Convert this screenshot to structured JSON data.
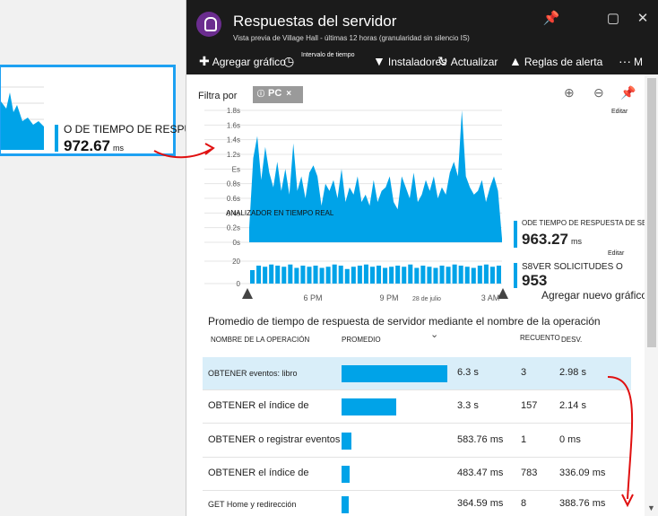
{
  "tile": {
    "metric_label": "O DE TIEMPO DE RESPUESTA DE SERVIDOR",
    "metric_value": "972.67",
    "metric_unit": "ms"
  },
  "blade": {
    "title": "Respuestas del servidor",
    "subtitle": "Vista previa de Village Hall - últimas 12 horas (granularidad sin silencio IS)",
    "controls": {
      "pin": "pin-icon",
      "maximize": "maximize-icon",
      "close": "close-icon"
    }
  },
  "toolbar": {
    "add_chart": "Agregar gráfico",
    "time_range": "Intervalo de tiempo",
    "installers": "Instaladores",
    "refresh": "Actualizar",
    "alert_rules": "Reglas de alerta",
    "more": "M"
  },
  "filter": {
    "label": "Filtra por",
    "chip": "PC"
  },
  "chart": {
    "edit_label": "Editar",
    "y_ticks": [
      "1.8s",
      "1.6s",
      "1.4s",
      "1.2s",
      "Es",
      "0.8s",
      "0.6s",
      "0.4s",
      "0.2s",
      "0s"
    ],
    "overlay_label": "ANALIZADOR EN TIEMPO REAL",
    "response_series": [
      0.2,
      1.15,
      1.45,
      0.85,
      1.3,
      0.95,
      0.75,
      1.1,
      0.7,
      1.0,
      0.65,
      1.35,
      0.7,
      0.9,
      0.6,
      0.95,
      1.05,
      0.9,
      0.5,
      0.8,
      0.7,
      0.85,
      0.6,
      1.0,
      0.55,
      0.75,
      0.65,
      0.9,
      0.55,
      0.65,
      0.5,
      0.85,
      0.55,
      0.7,
      0.75,
      0.9,
      0.55,
      0.45,
      0.9,
      0.75,
      0.6,
      0.95,
      0.55,
      0.65,
      0.85,
      0.7,
      0.9,
      0.6,
      0.75,
      0.65,
      0.95,
      1.1,
      0.9,
      1.8,
      0.9,
      0.75,
      0.65,
      0.7,
      0.85,
      0.55,
      0.75,
      0.9,
      0.7,
      0.05
    ],
    "count_y_ticks": [
      "20",
      "0"
    ],
    "count_series": [
      12,
      16,
      15,
      17,
      16,
      15,
      17,
      14,
      16,
      15,
      16,
      14,
      15,
      17,
      16,
      13,
      15,
      16,
      17,
      15,
      16,
      14,
      15,
      16,
      15,
      17,
      14,
      16,
      15,
      14,
      16,
      15,
      17,
      16,
      15,
      14,
      16,
      17,
      15,
      16
    ],
    "x_ticks": [
      "6 PM",
      "9 PM",
      "28 de julio",
      "3 AM"
    ],
    "metric1": {
      "label": "ODE TIEMPO DE RESPUESTA DE SERVIDOR",
      "value": "963.27",
      "unit": "ms",
      "edit": "Editar"
    },
    "metric2": {
      "label": "S8VER SOLICITUDES O",
      "value": "953"
    },
    "add_new_chart": "Agregar nuevo gráfico (D"
  },
  "grid": {
    "title": "Promedio de tiempo de respuesta de servidor mediante el nombre de la operación",
    "headers": [
      "NOMBRE DE LA OPERACIÓN",
      "PROMEDIO",
      "RECUENTO",
      "DESV."
    ],
    "rows": [
      {
        "name": "OBTENER eventos: libro",
        "avg": "6.3 s",
        "count": "3",
        "dev": "2.98 s",
        "ratio": 1.0
      },
      {
        "name": "OBTENER el índice de",
        "avg": "3.3 s",
        "count": "157",
        "dev": "2.14 s",
        "ratio": 0.52
      },
      {
        "name": "OBTENER o registrar eventos",
        "avg": "583.76 ms",
        "count": "1",
        "dev": "0 ms",
        "ratio": 0.09
      },
      {
        "name": "OBTENER el índice de",
        "avg": "483.47 ms",
        "count": "783",
        "dev": "336.09 ms",
        "ratio": 0.08
      },
      {
        "name": "GET Home y redirección",
        "avg": "364.59 ms",
        "count": "8",
        "dev": "388.76 ms",
        "ratio": 0.06
      }
    ]
  },
  "colors": {
    "accent": "#00a3e8",
    "header_bg": "#1b1b1b",
    "annotation": "#e01010",
    "selected_row": "#d9eef9"
  }
}
